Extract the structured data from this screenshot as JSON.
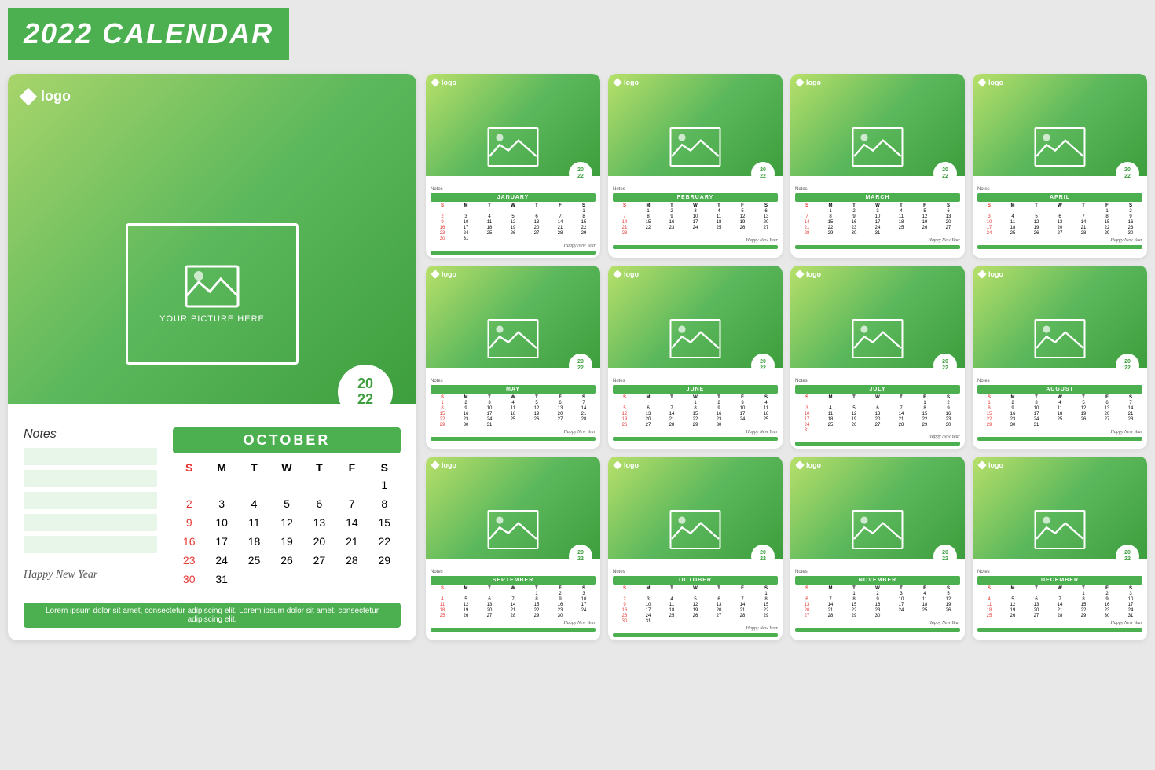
{
  "header": {
    "title": "2022 CALENDAR"
  },
  "big_calendar": {
    "logo": "logo",
    "picture_label": "YOUR PICTURE HERE",
    "year_badge": "20\n22",
    "notes_label": "Notes",
    "month_name": "OCTOBER",
    "happy_new_year": "Happy New Year",
    "footer_text": "Lorem ipsum dolor sit amet, consectetur adipiscing elit. Lorem ipsum dolor sit amet, consectetur adipiscing elit.",
    "days_header": [
      "S",
      "M",
      "T",
      "W",
      "T",
      "F",
      "S"
    ],
    "days": [
      {
        "d": "",
        "sun": false
      },
      {
        "d": "",
        "sun": false
      },
      {
        "d": "",
        "sun": false
      },
      {
        "d": "",
        "sun": false
      },
      {
        "d": "",
        "sun": false
      },
      {
        "d": "",
        "sun": false
      },
      {
        "d": "1",
        "sun": false
      },
      {
        "d": "2",
        "sun": true
      },
      {
        "d": "3",
        "sun": false
      },
      {
        "d": "4",
        "sun": false
      },
      {
        "d": "5",
        "sun": false
      },
      {
        "d": "6",
        "sun": false
      },
      {
        "d": "7",
        "sun": false
      },
      {
        "d": "8",
        "sun": false
      },
      {
        "d": "9",
        "sun": true
      },
      {
        "d": "10",
        "sun": false
      },
      {
        "d": "11",
        "sun": false
      },
      {
        "d": "12",
        "sun": false
      },
      {
        "d": "13",
        "sun": false
      },
      {
        "d": "14",
        "sun": false
      },
      {
        "d": "15",
        "sun": false
      },
      {
        "d": "16",
        "sun": true
      },
      {
        "d": "17",
        "sun": false
      },
      {
        "d": "18",
        "sun": false
      },
      {
        "d": "19",
        "sun": false
      },
      {
        "d": "20",
        "sun": false
      },
      {
        "d": "21",
        "sun": false
      },
      {
        "d": "22",
        "sun": false
      },
      {
        "d": "23",
        "sun": true
      },
      {
        "d": "24",
        "sun": false
      },
      {
        "d": "25",
        "sun": false
      },
      {
        "d": "26",
        "sun": false
      },
      {
        "d": "27",
        "sun": false
      },
      {
        "d": "28",
        "sun": false
      },
      {
        "d": "29",
        "sun": false
      },
      {
        "d": "30",
        "sun": true
      },
      {
        "d": "31",
        "sun": false
      },
      {
        "d": "",
        "sun": false
      },
      {
        "d": "",
        "sun": false
      },
      {
        "d": "",
        "sun": false
      },
      {
        "d": "",
        "sun": false
      },
      {
        "d": "",
        "sun": false
      }
    ]
  },
  "mini_calendars": [
    {
      "month": "JANUARY",
      "days": [
        "",
        "",
        "",
        "",
        "",
        "",
        "1",
        "2",
        "3",
        "4",
        "5",
        "6",
        "7",
        "8",
        "9",
        "10",
        "11",
        "12",
        "13",
        "14",
        "15",
        "16",
        "17",
        "18",
        "19",
        "20",
        "21",
        "22",
        "23",
        "24",
        "25",
        "26",
        "27",
        "28",
        "29",
        "30",
        "31",
        "",
        "",
        "",
        "",
        "",
        ""
      ]
    },
    {
      "month": "FEBRUARY",
      "days": [
        "",
        "1",
        "2",
        "3",
        "4",
        "5",
        "6",
        "7",
        "8",
        "9",
        "10",
        "11",
        "12",
        "13",
        "14",
        "15",
        "16",
        "17",
        "18",
        "19",
        "20",
        "21",
        "22",
        "23",
        "24",
        "25",
        "26",
        "27",
        "28",
        "",
        "",
        "",
        "",
        "",
        "",
        "",
        ""
      ]
    },
    {
      "month": "MARCH",
      "days": [
        "",
        "1",
        "2",
        "3",
        "4",
        "5",
        "6",
        "7",
        "8",
        "9",
        "10",
        "11",
        "12",
        "13",
        "14",
        "15",
        "16",
        "17",
        "18",
        "19",
        "20",
        "21",
        "22",
        "23",
        "24",
        "25",
        "26",
        "27",
        "28",
        "29",
        "30",
        "31",
        "",
        "",
        "",
        "",
        "",
        ""
      ]
    },
    {
      "month": "APRIL",
      "days": [
        "",
        "",
        "",
        "",
        "",
        "1",
        "2",
        "3",
        "4",
        "5",
        "6",
        "7",
        "8",
        "9",
        "10",
        "11",
        "12",
        "13",
        "14",
        "15",
        "16",
        "17",
        "18",
        "19",
        "20",
        "21",
        "22",
        "23",
        "24",
        "25",
        "26",
        "27",
        "28",
        "29",
        "30",
        "",
        "",
        "",
        "",
        "",
        "",
        ""
      ]
    },
    {
      "month": "MAY",
      "days": [
        "1",
        "2",
        "3",
        "4",
        "5",
        "6",
        "7",
        "8",
        "9",
        "10",
        "11",
        "12",
        "13",
        "14",
        "15",
        "16",
        "17",
        "18",
        "19",
        "20",
        "21",
        "22",
        "23",
        "24",
        "25",
        "26",
        "27",
        "28",
        "29",
        "30",
        "31",
        "",
        "",
        "",
        "",
        "",
        "",
        ""
      ]
    },
    {
      "month": "JUNE",
      "days": [
        "",
        "",
        "",
        "1",
        "2",
        "3",
        "4",
        "5",
        "6",
        "7",
        "8",
        "9",
        "10",
        "11",
        "12",
        "13",
        "14",
        "15",
        "16",
        "17",
        "18",
        "19",
        "20",
        "21",
        "22",
        "23",
        "24",
        "25",
        "26",
        "27",
        "28",
        "29",
        "30",
        "",
        "",
        "",
        "",
        "",
        ""
      ]
    },
    {
      "month": "JULY",
      "days": [
        "",
        "",
        "",
        "",
        "",
        "1",
        "2",
        "3",
        "4",
        "5",
        "6",
        "7",
        "8",
        "9",
        "10",
        "11",
        "12",
        "13",
        "14",
        "15",
        "16",
        "17",
        "18",
        "19",
        "20",
        "21",
        "22",
        "23",
        "24",
        "25",
        "26",
        "27",
        "28",
        "29",
        "30",
        "31",
        "",
        "",
        "",
        "",
        ""
      ]
    },
    {
      "month": "AUGUST",
      "days": [
        "1",
        "2",
        "3",
        "4",
        "5",
        "6",
        "7",
        "8",
        "9",
        "10",
        "11",
        "12",
        "13",
        "14",
        "15",
        "16",
        "17",
        "18",
        "19",
        "20",
        "21",
        "22",
        "23",
        "24",
        "25",
        "26",
        "27",
        "28",
        "29",
        "30",
        "31",
        "",
        "",
        "",
        "",
        "",
        "",
        ""
      ]
    },
    {
      "month": "SEPTEMBER",
      "days": [
        "",
        "",
        "",
        "",
        "1",
        "2",
        "3",
        "4",
        "5",
        "6",
        "7",
        "8",
        "9",
        "10",
        "11",
        "12",
        "13",
        "14",
        "15",
        "16",
        "17",
        "18",
        "19",
        "20",
        "21",
        "22",
        "23",
        "24",
        "25",
        "26",
        "27",
        "28",
        "29",
        "30",
        "",
        "",
        "",
        "",
        "",
        ""
      ]
    },
    {
      "month": "OCTOBER",
      "days": [
        "",
        "",
        "",
        "",
        "",
        "",
        "1",
        "2",
        "3",
        "4",
        "5",
        "6",
        "7",
        "8",
        "9",
        "10",
        "11",
        "12",
        "13",
        "14",
        "15",
        "16",
        "17",
        "18",
        "19",
        "20",
        "21",
        "22",
        "23",
        "24",
        "25",
        "26",
        "27",
        "28",
        "29",
        "30",
        "31",
        "",
        "",
        "",
        "",
        "",
        ""
      ]
    },
    {
      "month": "NOVEMBER",
      "days": [
        "",
        "",
        "1",
        "2",
        "3",
        "4",
        "5",
        "6",
        "7",
        "8",
        "9",
        "10",
        "11",
        "12",
        "13",
        "14",
        "15",
        "16",
        "17",
        "18",
        "19",
        "20",
        "21",
        "22",
        "23",
        "24",
        "25",
        "26",
        "27",
        "28",
        "29",
        "30",
        "",
        "",
        "",
        "",
        "",
        ""
      ]
    },
    {
      "month": "DECEMBER",
      "days": [
        "",
        "",
        "",
        "",
        "1",
        "2",
        "3",
        "4",
        "5",
        "6",
        "7",
        "8",
        "9",
        "10",
        "11",
        "12",
        "13",
        "14",
        "15",
        "16",
        "17",
        "18",
        "19",
        "20",
        "21",
        "22",
        "23",
        "24",
        "25",
        "26",
        "27",
        "28",
        "29",
        "30",
        "31",
        "",
        "",
        "",
        "",
        ""
      ]
    }
  ]
}
